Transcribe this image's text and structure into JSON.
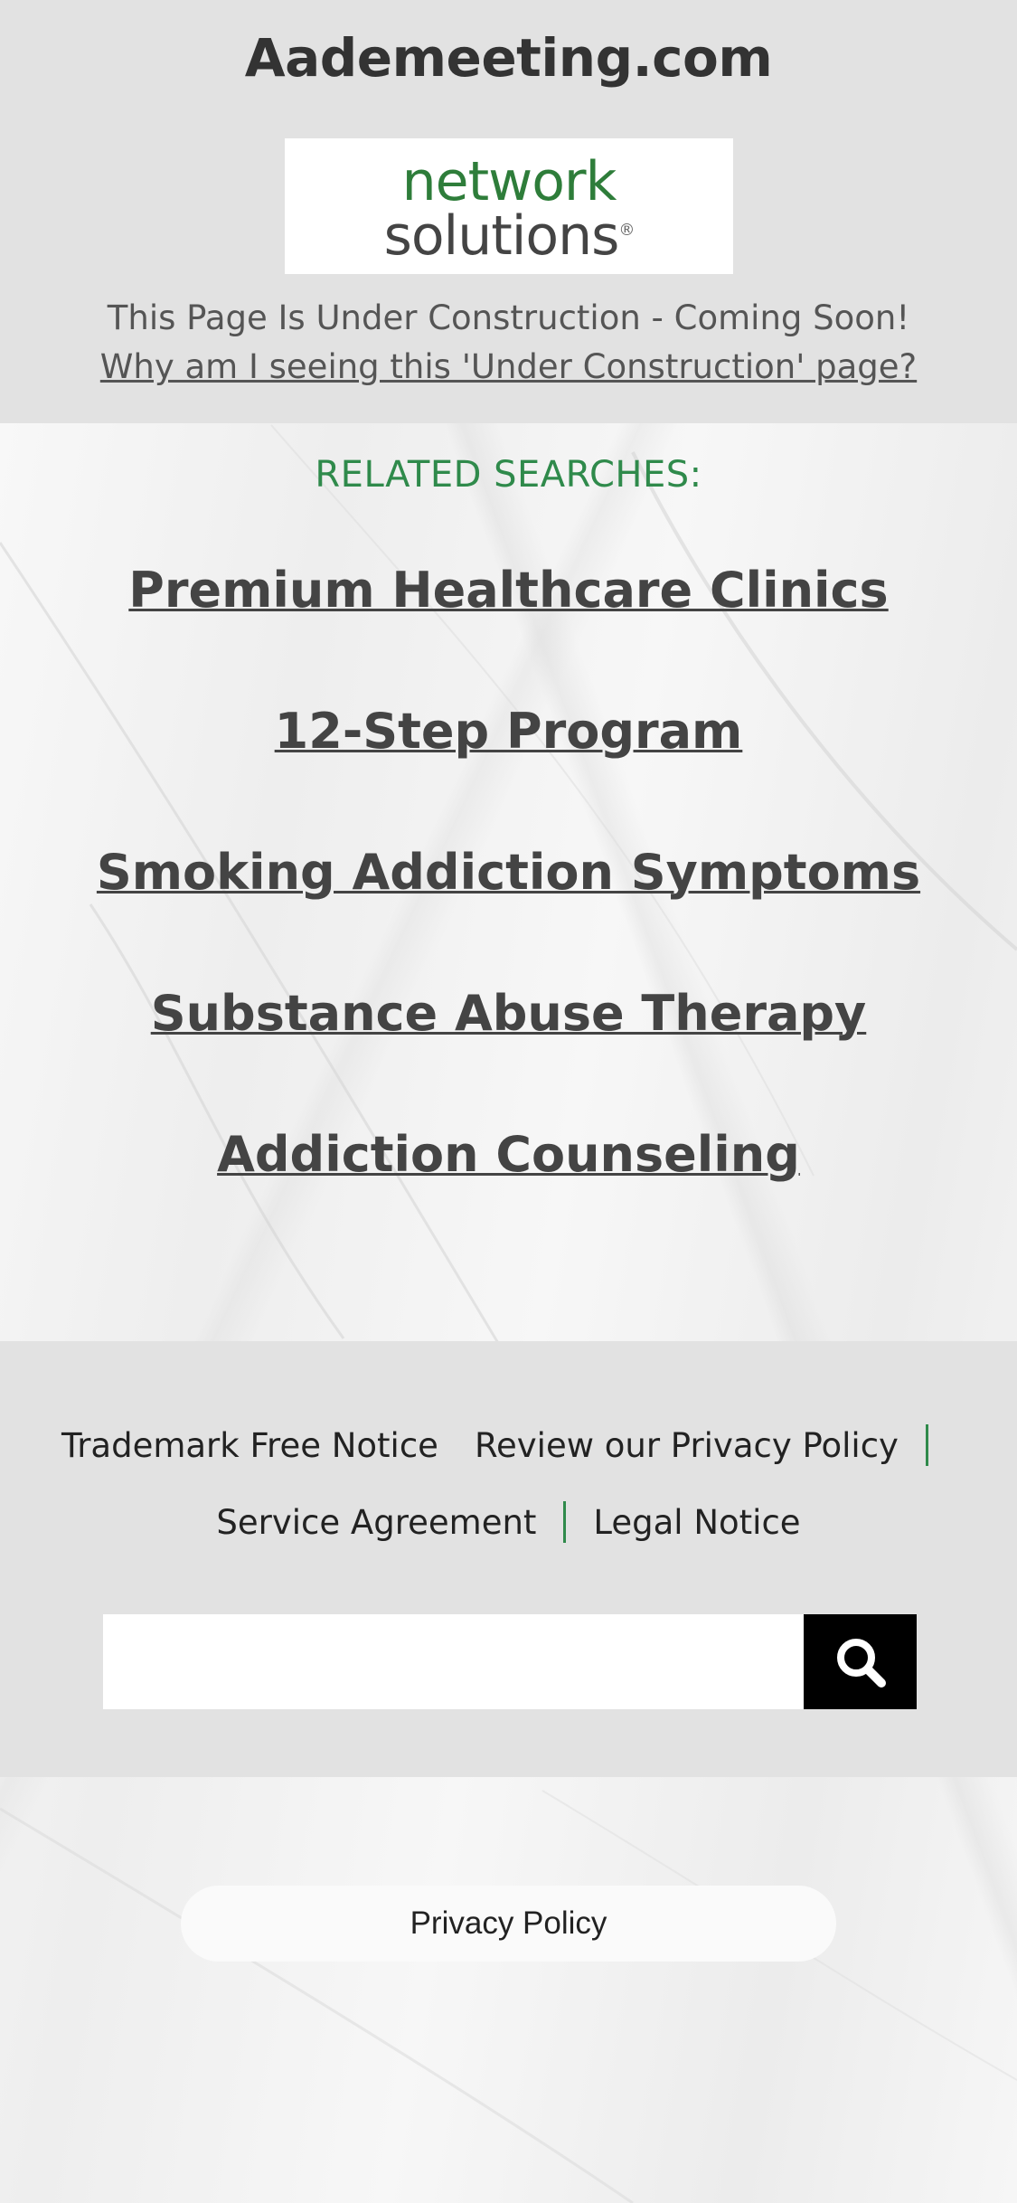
{
  "header": {
    "site_title": "Aademeeting.com",
    "logo_line1": "network",
    "logo_line2": "solutions",
    "logo_reg": "®",
    "status_text": "This Page Is Under Construction - Coming Soon!",
    "why_link": "Why am I seeing this 'Under Construction' page?"
  },
  "related": {
    "title": "RELATED SEARCHES:",
    "links": [
      "Premium Healthcare Clinics",
      "12-Step Program",
      "Smoking Addiction Symptoms",
      "Substance Abuse Therapy",
      "Addiction Counseling"
    ]
  },
  "footer": {
    "trademark": "Trademark Free Notice",
    "privacy": "Review our Privacy Policy",
    "service": "Service Agreement",
    "legal": "Legal Notice",
    "search_value": "",
    "search_icon": "search-icon"
  },
  "bottom": {
    "privacy_policy": "Privacy Policy"
  },
  "colors": {
    "accent_green": "#2f8a4b",
    "header_bg": "#e2e2e2",
    "search_button_bg": "#000000"
  }
}
